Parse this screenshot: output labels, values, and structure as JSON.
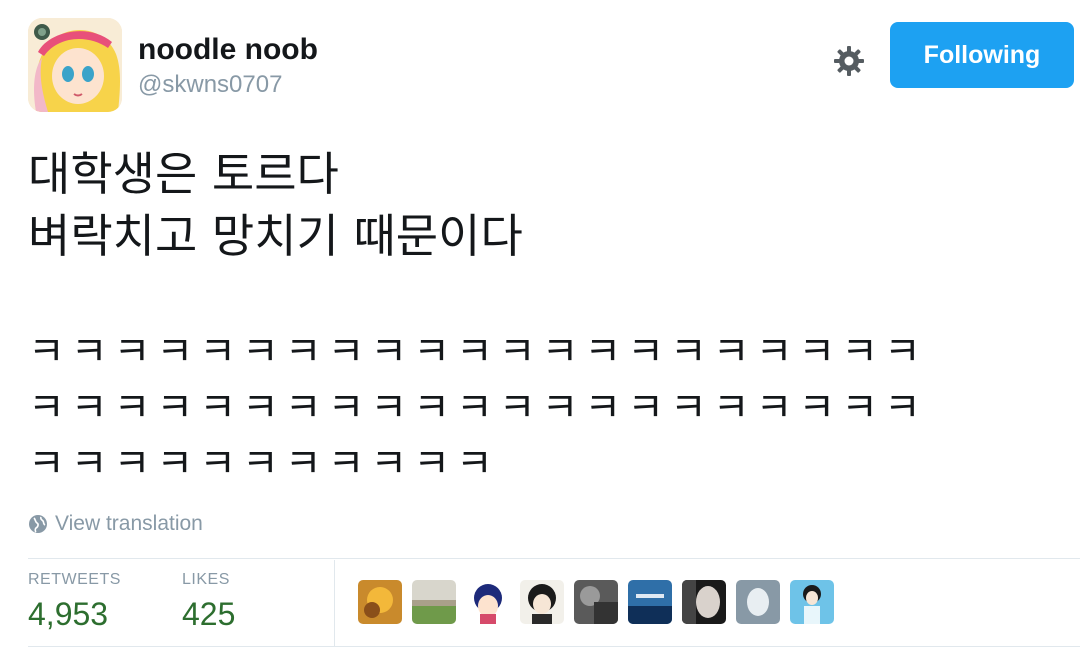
{
  "user": {
    "display_name": "noodle noob",
    "handle": "@skwns0707"
  },
  "actions": {
    "settings_icon": "gear-icon",
    "follow_label": "Following"
  },
  "tweet": {
    "line1": "대학생은 토르다",
    "line2": "벼락치고 망치기 때문이다",
    "laugh_line1": "ㅋㅋㅋㅋㅋㅋㅋㅋㅋㅋㅋㅋㅋㅋㅋㅋㅋㅋㅋㅋㅋ",
    "laugh_line2": "ㅋㅋㅋㅋㅋㅋㅋㅋㅋㅋㅋㅋㅋㅋㅋㅋㅋㅋㅋㅋㅋ",
    "laugh_line3": "ㅋㅋㅋㅋㅋㅋㅋㅋㅋㅋㅋ"
  },
  "translation": {
    "icon": "globe-icon",
    "label": "View translation"
  },
  "stats": {
    "retweets_label": "RETWEETS",
    "retweets_value": "4,953",
    "likes_label": "LIKES",
    "likes_value": "425"
  },
  "colors": {
    "follow_button": "#1da1f2",
    "stat_value": "#2d6e2f",
    "muted_text": "#8899a6"
  }
}
